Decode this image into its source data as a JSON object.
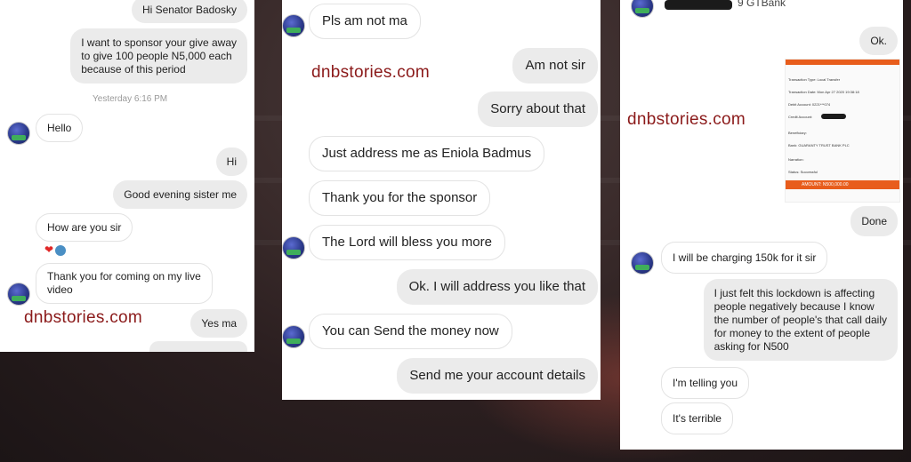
{
  "watermark": "dnbstories.com",
  "panel1": {
    "messages": [
      {
        "text": "Hi Senator Badosky",
        "dir": "out"
      },
      {
        "text": "I want to sponsor your give away\nto give 100 people N5,000 each\nbecause of this period",
        "dir": "out"
      },
      {
        "text": "Hello",
        "dir": "in"
      },
      {
        "text": "Hi",
        "dir": "out"
      },
      {
        "text": "Good evening sister me",
        "dir": "out"
      },
      {
        "text": "How are you sir",
        "dir": "in"
      },
      {
        "text": "Thank you for coming on my live\nvideo",
        "dir": "in"
      },
      {
        "text": "Yes ma",
        "dir": "out"
      }
    ],
    "timestamp": "Yesterday 6:16 PM",
    "reaction": "❤"
  },
  "panel2": {
    "messages": [
      {
        "text": "Pls am not ma",
        "dir": "in"
      },
      {
        "text": "Am not sir",
        "dir": "out"
      },
      {
        "text": "Sorry about that",
        "dir": "out"
      },
      {
        "text": "Just address me as Eniola Badmus",
        "dir": "in"
      },
      {
        "text": "Thank you for the sponsor",
        "dir": "in"
      },
      {
        "text": "The Lord will bless you more",
        "dir": "in"
      },
      {
        "text": "Ok. I will address you like that",
        "dir": "out"
      },
      {
        "text": "You can Send the money now",
        "dir": "in"
      },
      {
        "text": "Send me your account details",
        "dir": "out"
      }
    ]
  },
  "panel3": {
    "header_name": "9 GTBank",
    "messages": [
      {
        "text": "Ok.",
        "dir": "out"
      },
      {
        "text": "Done",
        "dir": "out"
      },
      {
        "text": "I will be charging 150k for it sir",
        "dir": "in"
      },
      {
        "text": "I just felt this lockdown is affecting\npeople negatively because I know\nthe number of people's that call daily\nfor money to the extent of people\nasking for N500",
        "dir": "out"
      },
      {
        "text": "I'm telling you",
        "dir": "in"
      },
      {
        "text": "It's terrible",
        "dir": "in"
      }
    ],
    "receipt": {
      "rows": [
        "Transaction Type: Local Transfer",
        "Transaction Date: Mon Apr 27 2020 19:38:18",
        "Debit Account: 0221***074",
        "Credit Account:",
        "Beneficiary:",
        "Bank: GUARANTY TRUST BANK PLC",
        "Narration:",
        "Status: Successful"
      ],
      "amount": "AMOUNT: N500,000.00"
    }
  },
  "colors": {
    "watermark": "#8b1a1a",
    "bubble": "#efefef",
    "receipt_accent": "#e85d1c"
  }
}
